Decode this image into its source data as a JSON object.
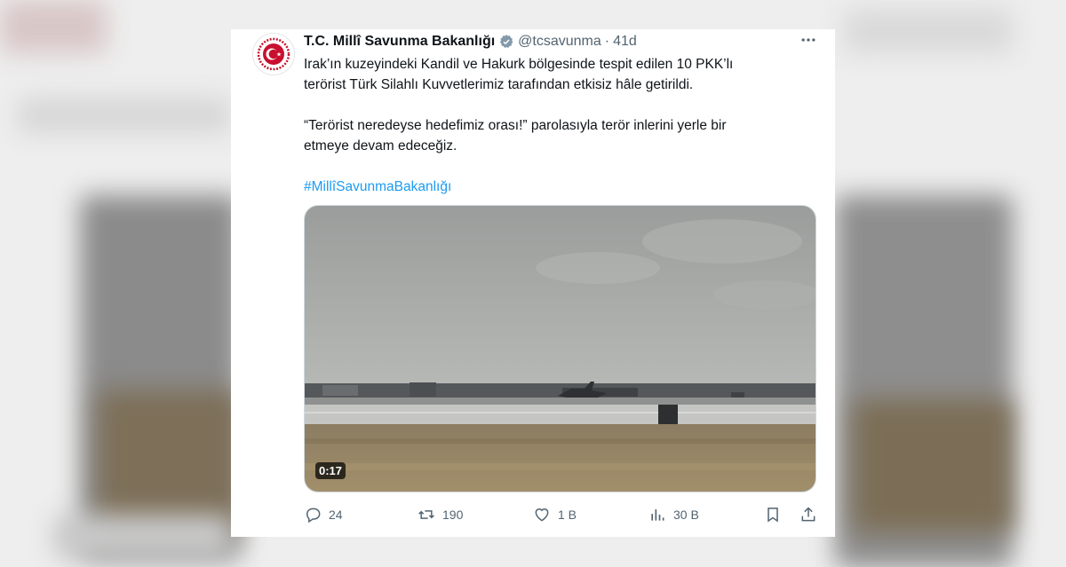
{
  "tweet": {
    "author_name": "T.C. Millî Savunma Bakanlığı",
    "handle": "@tcsavunma",
    "separator": "·",
    "time": "41d",
    "paragraph1": "Irak’ın kuzeyindeki Kandil ve Hakurk bölgesinde tespit edilen 10 PKK’lı\nterörist Türk Silahlı Kuvvetlerimiz tarafından etkisiz hâle getirildi.",
    "paragraph2": "“Terörist neredeyse hedefimiz orası!” parolasıyla terör inlerini yerle bir\netmeye devam edeceğiz.",
    "hashtag": "#MillîSavunmaBakanlığı",
    "video_duration": "0:17"
  },
  "actions": {
    "replies": "24",
    "retweets": "190",
    "likes": "1 B",
    "views": "30 B"
  },
  "icons": {
    "avatar": "ministry-emblem-icon",
    "verified": "verified-badge-icon",
    "more": "more-icon",
    "reply": "reply-icon",
    "retweet": "retweet-icon",
    "like": "heart-icon",
    "views": "views-icon",
    "bookmark": "bookmark-icon",
    "share": "share-icon"
  },
  "colors": {
    "link": "#1d9bf0",
    "muted": "#536471",
    "emblem": "#c8102e"
  }
}
